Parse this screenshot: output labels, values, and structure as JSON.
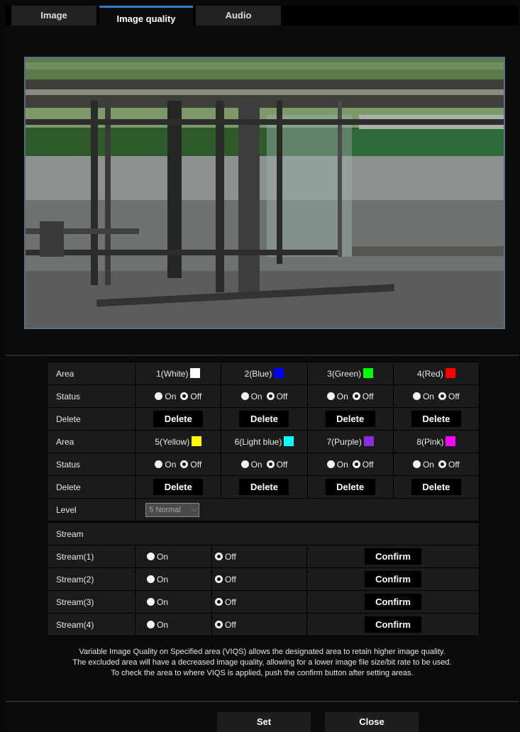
{
  "tabs": [
    {
      "label": "Image"
    },
    {
      "label": "Image quality"
    },
    {
      "label": "Audio"
    }
  ],
  "active_tab": "Image quality",
  "area_table": {
    "rows": [
      {
        "label": "Area",
        "cells": [
          "1(White)",
          "2(Blue)",
          "3(Green)",
          "4(Red)"
        ],
        "colors": [
          "#ffffff",
          "#0000ff",
          "#00ff00",
          "#ff0000"
        ]
      },
      {
        "label": "Status"
      },
      {
        "label": "Delete"
      },
      {
        "label": "Area",
        "cells": [
          "5(Yellow)",
          "6(Light blue)",
          "7(Purple)",
          "8(Pink)"
        ],
        "colors": [
          "#ffff00",
          "#00ffff",
          "#8a2be2",
          "#ff00ff"
        ]
      },
      {
        "label": "Status"
      },
      {
        "label": "Delete"
      }
    ],
    "on_label": "On",
    "off_label": "Off",
    "delete_label": "Delete",
    "status_selected": "Off",
    "level_label": "Level",
    "level_value": "5 Normal"
  },
  "stream_table": {
    "header": "Stream",
    "rows": [
      {
        "label": "Stream(1)",
        "selected": "Off"
      },
      {
        "label": "Stream(2)",
        "selected": "Off"
      },
      {
        "label": "Stream(3)",
        "selected": "Off"
      },
      {
        "label": "Stream(4)",
        "selected": "Off"
      }
    ],
    "on_label": "On",
    "off_label": "Off",
    "confirm_label": "Confirm"
  },
  "note": {
    "line1": "Variable Image Quality on Specified area (VIQS) allows the designated area to retain higher image quality.",
    "line2": "The excluded area will have a decreased image quality, allowing for a lower image file size/bit rate to be used.",
    "line3": "To check the area to where VIQS is applied, push the confirm button after setting areas."
  },
  "footer": {
    "set_label": "Set",
    "close_label": "Close"
  }
}
